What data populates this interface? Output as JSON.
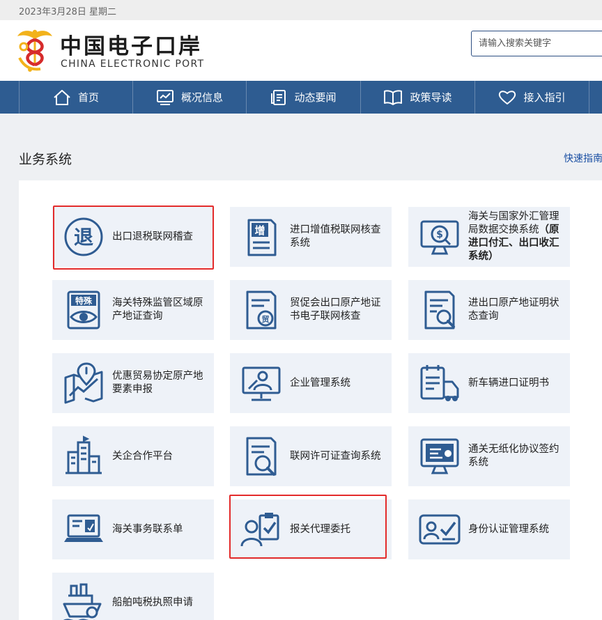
{
  "topbar": {
    "date": "2023年3月28日 星期二"
  },
  "header": {
    "brand_cn": "中国电子口岸",
    "brand_en": "CHINA ELECTRONIC PORT",
    "search_placeholder": "请输入搜索关键字"
  },
  "nav": [
    {
      "label": "首页",
      "icon": "home-icon"
    },
    {
      "label": "概况信息",
      "icon": "chart-icon"
    },
    {
      "label": "动态要闻",
      "icon": "news-icon"
    },
    {
      "label": "政策导读",
      "icon": "book-icon"
    },
    {
      "label": "接入指引",
      "icon": "heart-icon"
    }
  ],
  "section": {
    "title": "业务系统",
    "quick_link": "快速指南"
  },
  "systems": [
    {
      "label": "出口退税联网稽查",
      "icon": "tax-refund-icon",
      "highlighted": true
    },
    {
      "label": "进口增值税联网核查系统",
      "icon": "vat-document-icon"
    },
    {
      "label": "海关与国家外汇管理局数据交换系统",
      "label_bold": "（原进口付汇、出口收汇系统）",
      "icon": "forex-monitor-icon"
    },
    {
      "label": "海关特殊监管区域原产地证查询",
      "icon": "special-zone-eye-icon",
      "icon_text": "特殊"
    },
    {
      "label": "贸促会出口原产地证书电子联网核查",
      "icon": "certificate-stamp-icon",
      "icon_text": "贸"
    },
    {
      "label": "进出口原产地证明状态查询",
      "icon": "document-search-icon"
    },
    {
      "label": "优惠贸易协定原产地要素申报",
      "icon": "map-pin-icon"
    },
    {
      "label": "企业管理系统",
      "icon": "enterprise-screen-icon"
    },
    {
      "label": "新车辆进口证明书",
      "icon": "vehicle-document-icon"
    },
    {
      "label": "关企合作平台",
      "icon": "city-buildings-icon"
    },
    {
      "label": "联网许可证查询系统",
      "icon": "license-search-icon"
    },
    {
      "label": "通关无纸化协议签约系统",
      "icon": "paperless-screen-icon"
    },
    {
      "label": "海关事务联系单",
      "icon": "laptop-contact-icon"
    },
    {
      "label": "报关代理委托",
      "icon": "agent-clipboard-icon",
      "highlighted": true
    },
    {
      "label": "身份认证管理系统",
      "icon": "id-card-check-icon"
    },
    {
      "label": "船舶吨税执照申请",
      "icon": "ship-icon"
    }
  ],
  "colors": {
    "nav_bg": "#2e5c91",
    "icon_blue": "#2f5c92",
    "tile_bg": "#eef2f8",
    "highlight_red": "#e32b2b",
    "link_blue": "#1a4fa3"
  }
}
